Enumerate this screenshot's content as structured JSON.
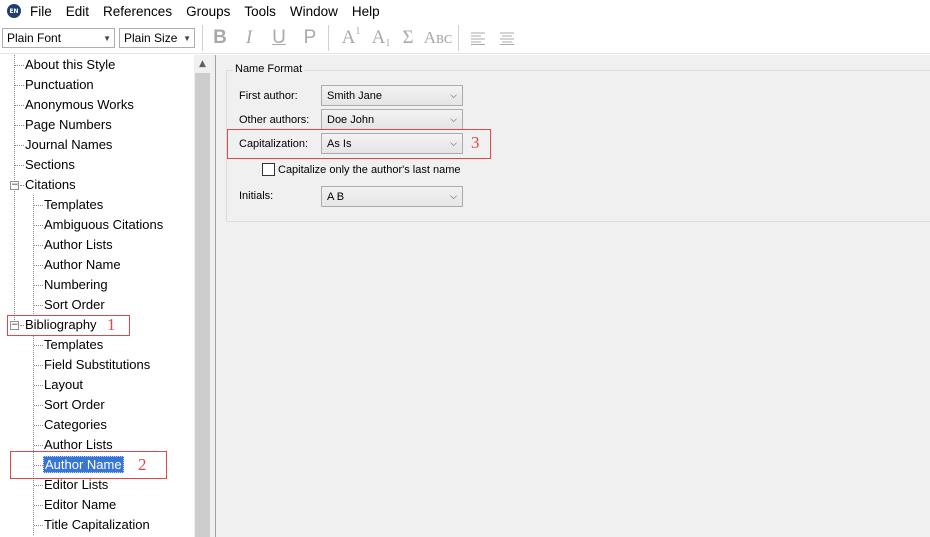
{
  "app_icon_text": "EN",
  "menu": [
    "File",
    "Edit",
    "References",
    "Groups",
    "Tools",
    "Window",
    "Help"
  ],
  "toolbar": {
    "font_value": "Plain Font",
    "size_value": "Plain Size",
    "bold": "B",
    "italic": "I",
    "underline": "U",
    "plain": "P",
    "superscript": "A",
    "superscript_mark": "1",
    "subscript": "A",
    "subscript_mark": "1",
    "symbol": "Σ",
    "smallcaps": "Aʙᴄ"
  },
  "tree": {
    "about": "About this Style",
    "punctuation": "Punctuation",
    "anonymous": "Anonymous Works",
    "page_numbers": "Page Numbers",
    "journal_names": "Journal Names",
    "sections": "Sections",
    "citations": "Citations",
    "cit_templates": "Templates",
    "cit_ambiguous": "Ambiguous Citations",
    "cit_author_lists": "Author Lists",
    "cit_author_name": "Author Name",
    "cit_numbering": "Numbering",
    "cit_sort_order": "Sort Order",
    "bibliography": "Bibliography",
    "bib_templates": "Templates",
    "bib_field_subs": "Field Substitutions",
    "bib_layout": "Layout",
    "bib_sort_order": "Sort Order",
    "bib_categories": "Categories",
    "bib_author_lists": "Author Lists",
    "bib_author_name": "Author Name",
    "bib_editor_lists": "Editor Lists",
    "bib_editor_name": "Editor Name",
    "bib_title_cap": "Title Capitalization"
  },
  "form": {
    "group_title": "Name Format",
    "first_author_label": "First author:",
    "first_author_value": "Smith Jane",
    "other_authors_label": "Other authors:",
    "other_authors_value": "Doe John",
    "capitalization_label": "Capitalization:",
    "capitalization_value": "As Is",
    "capitalize_last_label": "Capitalize only the author's last name",
    "initials_label": "Initials:",
    "initials_value": "A B"
  },
  "annotations": {
    "n1": "1",
    "n2": "2",
    "n3": "3"
  },
  "colors": {
    "selection": "#3875d7",
    "annotation": "#e0464a",
    "panel_bg": "#f0f0f0"
  }
}
